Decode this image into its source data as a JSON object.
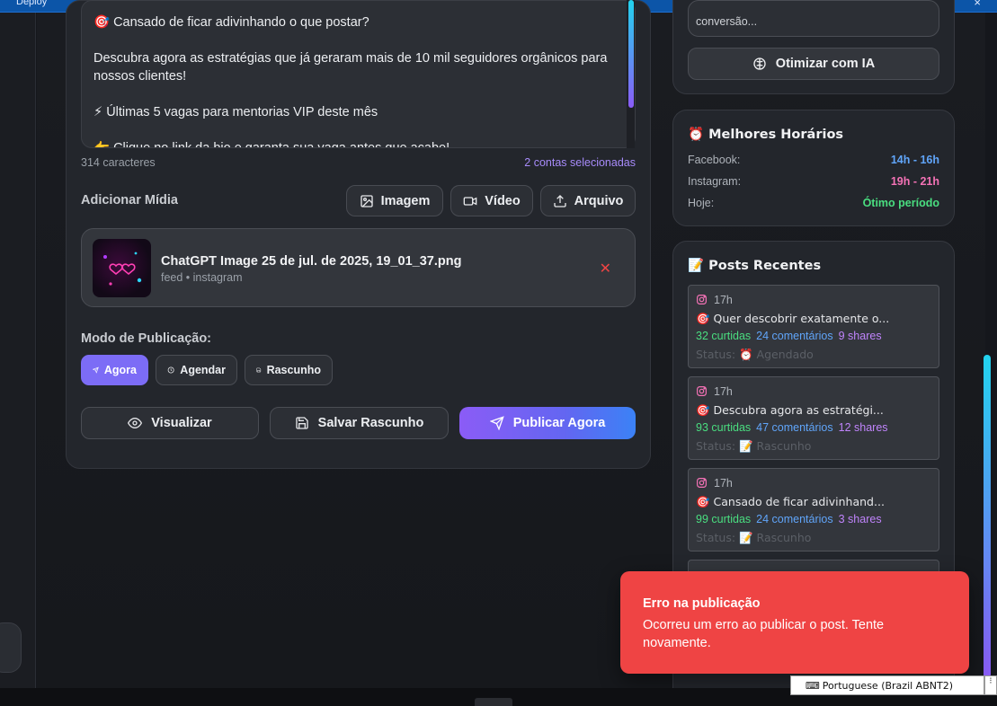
{
  "window": {
    "deploy_label": "Deploy",
    "close_glyph": "×"
  },
  "composer": {
    "lines": [
      "🎯 Cansado de ficar adivinhando o que postar?",
      "Descubra agora as estratégias que já geraram mais de 10 mil seguidores orgânicos para nossos clientes!",
      "⚡ Últimas 5 vagas para mentorias VIP deste mês",
      "👉 Clique no link da bio e garanta sua vaga antes que acabe!"
    ],
    "char_count": "314 caracteres",
    "accounts_selected": "2 contas selecionadas"
  },
  "media": {
    "label": "Adicionar Mídia",
    "buttons": {
      "image": "Imagem",
      "video": "Vídeo",
      "file": "Arquivo"
    },
    "attachment": {
      "name": "ChatGPT Image 25 de jul. de 2025, 19_01_37.png",
      "sub": "feed • instagram",
      "remove_glyph": "✕"
    }
  },
  "publish_mode": {
    "label": "Modo de Publicação:",
    "options": [
      "Agora",
      "Agendar",
      "Rascunho"
    ],
    "selected": "Agora"
  },
  "actions": {
    "preview": "Visualizar",
    "save_draft": "Salvar Rascunho",
    "publish_now": "Publicar Agora"
  },
  "ai_card": {
    "top_text": "conversão...",
    "optimize_label": "Otimizar com IA"
  },
  "best_times": {
    "title": "⏰ Melhores Horários",
    "rows": [
      {
        "label": "Facebook:",
        "value": "14h - 16h",
        "color": "#60a5fa"
      },
      {
        "label": "Instagram:",
        "value": "19h - 21h",
        "color": "#f472b6"
      },
      {
        "label": "Hoje:",
        "value": "Ótimo período",
        "color": "#4ade80"
      }
    ]
  },
  "recent_posts": {
    "title": "📝 Posts Recentes",
    "items": [
      {
        "time": "17h",
        "text": "🎯 Quer descobrir exatamente o...",
        "likes": "32 curtidas",
        "comments": "24 comentários",
        "shares": "9 shares",
        "status": "Status: ⏰ Agendado"
      },
      {
        "time": "17h",
        "text": "🎯 Descubra agora as estratégi...",
        "likes": "93 curtidas",
        "comments": "47 comentários",
        "shares": "12 shares",
        "status": "Status: 📝 Rascunho"
      },
      {
        "time": "17h",
        "text": "🎯 Cansado de ficar adivinhand...",
        "likes": "99 curtidas",
        "comments": "24 comentários",
        "shares": "3 shares",
        "status": "Status: 📝 Rascunho"
      }
    ]
  },
  "toast": {
    "title": "Erro na publicação",
    "message": "Ocorreu um erro ao publicar o post. Tente novamente.",
    "color": "#ef4444"
  },
  "ime": {
    "label": "Portuguese (Brazil ABNT2)"
  },
  "colors": {
    "accent": "#7c6cf6",
    "background": "#15171c",
    "panel": "#23262c"
  }
}
